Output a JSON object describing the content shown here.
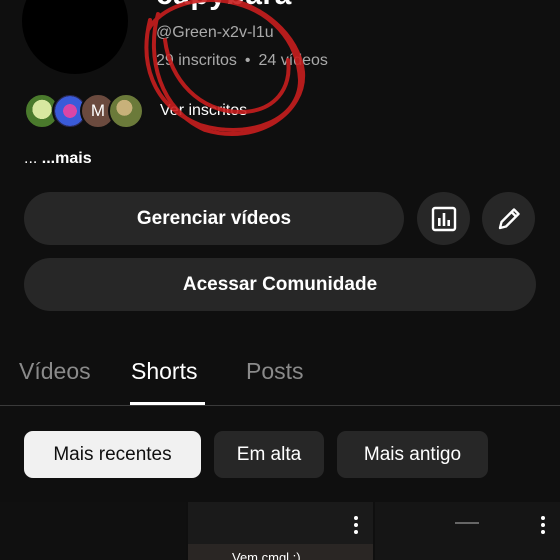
{
  "channel": {
    "name": "capybara",
    "handle": "@Green-x2v-l1u",
    "subscribers": "29 inscritos",
    "separator": "•",
    "videos": "24 vídeos"
  },
  "subscribers_preview": {
    "avatars": [
      "",
      "",
      "M",
      ""
    ],
    "link_label": "Ver inscritos"
  },
  "description": {
    "prefix": "... ",
    "more": "...mais"
  },
  "actions": {
    "manage_videos": "Gerenciar vídeos",
    "community": "Acessar Comunidade",
    "analytics_icon": "analytics-icon",
    "edit_icon": "pencil-icon"
  },
  "tabs": [
    "Vídeos",
    "Shorts",
    "Posts"
  ],
  "active_tab": "Shorts",
  "filters": [
    "Mais recentes",
    "Em alta",
    "Mais antigo"
  ],
  "selected_filter": "Mais recentes",
  "shorts": [
    {
      "caption": ""
    },
    {
      "caption": "Vem cmgl ;)"
    },
    {
      "caption": ""
    }
  ],
  "colors": {
    "background": "#0f0f0f",
    "button": "#272727",
    "scribble": "#c81e1e"
  }
}
